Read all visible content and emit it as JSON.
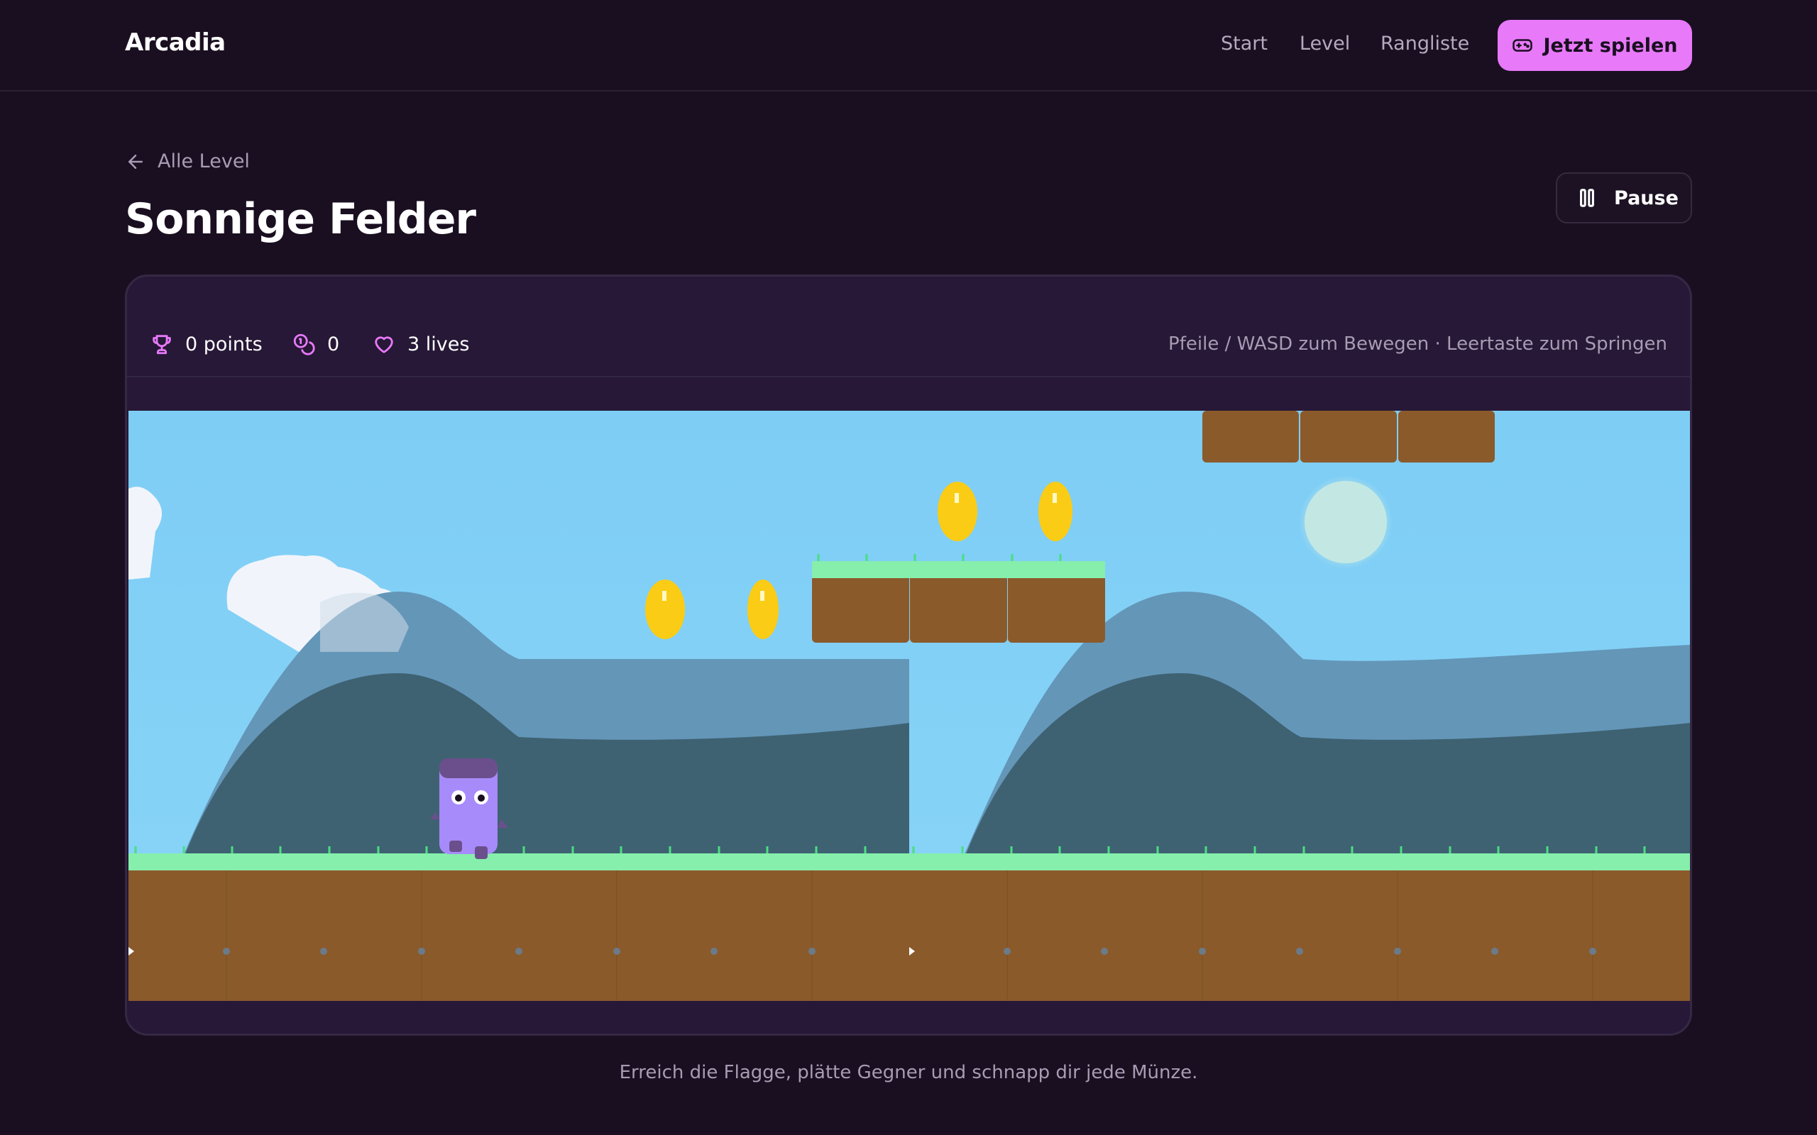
{
  "nav": {
    "brand": "Arcadia",
    "links": [
      "Start",
      "Level",
      "Rangliste"
    ],
    "cta_label": "Jetzt spielen"
  },
  "header": {
    "back_label": "Alle Level",
    "title": "Sonnige Felder",
    "pause_label": "Pause"
  },
  "hud": {
    "points": "0 points",
    "coins": "0",
    "lives": "3 lives",
    "controls_hint": "Pfeile / WASD zum Bewegen · Leertaste zum Springen"
  },
  "game": {
    "coins_visible": 4,
    "colors": {
      "sky": "#7ecdf5",
      "grass": "#86efac",
      "dirt": "#8b5a2b",
      "coin": "#facc15",
      "player": "#a78bfa",
      "hill_far": "#6496b8",
      "hill_near": "#3e6272"
    }
  },
  "caption": "Erreich die Flagge, plätte Gegner und schnapp dir jede Münze.",
  "icons": {
    "cta": "gamepad-icon",
    "back": "arrow-left-icon",
    "pause": "pause-icon",
    "points": "trophy-icon",
    "coins": "coins-icon",
    "lives": "heart-icon"
  }
}
